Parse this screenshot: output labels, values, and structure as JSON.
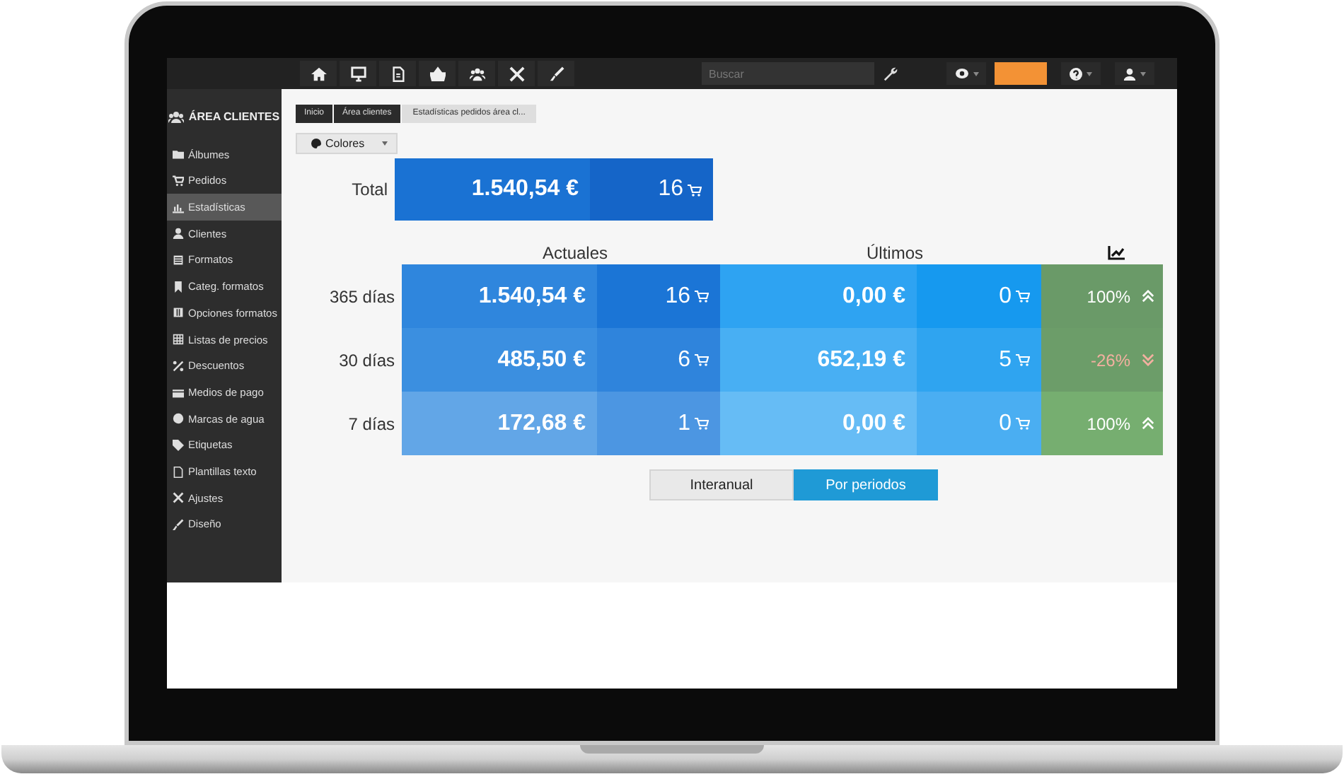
{
  "top_bar": {
    "search": {
      "placeholder": "Buscar"
    }
  },
  "sidebar": {
    "title": "ÁREA CLIENTES",
    "items": [
      {
        "label": "Álbumes",
        "selected": false
      },
      {
        "label": "Pedidos",
        "selected": false
      },
      {
        "label": "Estadísticas",
        "selected": true
      },
      {
        "label": "Clientes",
        "selected": false
      },
      {
        "label": "Formatos",
        "selected": false
      },
      {
        "label": "Categ. formatos",
        "selected": false
      },
      {
        "label": "Opciones formatos",
        "selected": false
      },
      {
        "label": "Listas de precios",
        "selected": false
      },
      {
        "label": "Descuentos",
        "selected": false
      },
      {
        "label": "Medios de pago",
        "selected": false
      },
      {
        "label": "Marcas de agua",
        "selected": false
      },
      {
        "label": "Etiquetas",
        "selected": false
      },
      {
        "label": "Plantillas texto",
        "selected": false
      },
      {
        "label": "Ajustes",
        "selected": false
      },
      {
        "label": "Diseño",
        "selected": false
      }
    ]
  },
  "breadcrumb": [
    "Inicio",
    "Área clientes",
    "Estadísticas pedidos área cl..."
  ],
  "colors_dropdown": "Colores",
  "total": {
    "label": "Total",
    "amount": "1.540,54 €",
    "orders": "16"
  },
  "headers": [
    "Actuales",
    "Últimos"
  ],
  "rows": [
    {
      "period": "365 días",
      "current_amount": "1.540,54 €",
      "current_orders": "16",
      "last_amount": "0,00 €",
      "last_orders": "0",
      "change": "100%",
      "rising": true
    },
    {
      "period": "30 días",
      "current_amount": "485,50 €",
      "current_orders": "6",
      "last_amount": "652,19 €",
      "last_orders": "5",
      "change": "-26%",
      "rising": false
    },
    {
      "period": "7 días",
      "current_amount": "172,68 €",
      "current_orders": "1",
      "last_amount": "0,00 €",
      "last_orders": "0",
      "change": "100%",
      "rising": true
    }
  ],
  "mode_tabs": [
    {
      "label": "Interanual",
      "selected": false
    },
    {
      "label": "Por periodos",
      "selected": true
    }
  ]
}
